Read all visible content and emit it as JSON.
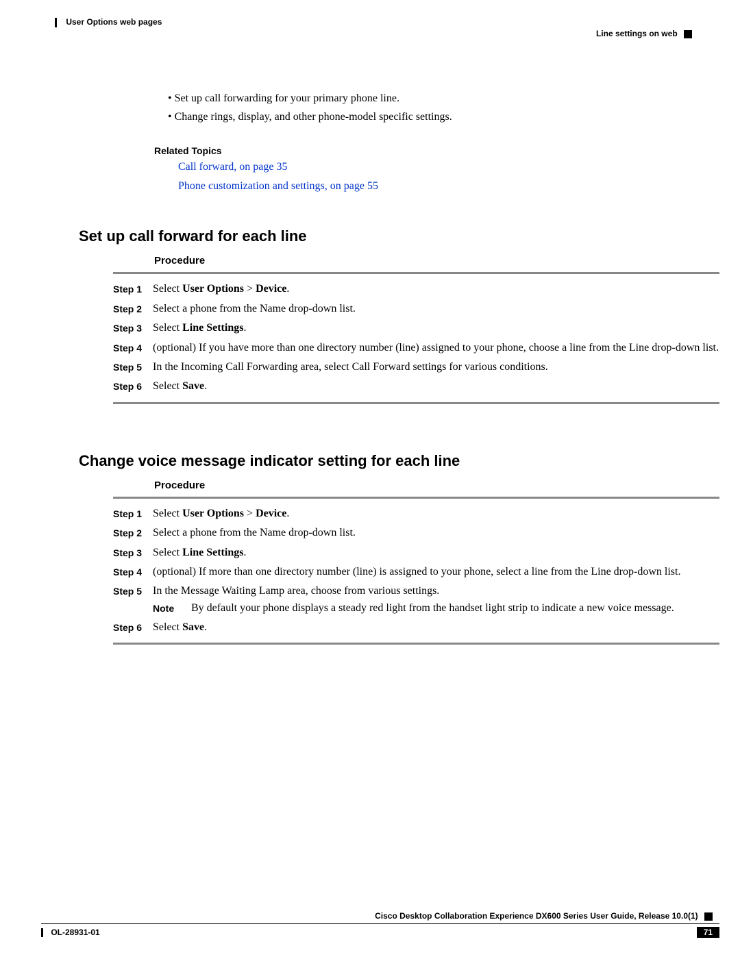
{
  "header": {
    "left": "User Options web pages",
    "right": "Line settings on web"
  },
  "intro": {
    "bullets": [
      "Set up call forwarding for your primary phone line.",
      "Change rings, display, and other phone-model specific settings."
    ],
    "related_heading": "Related Topics",
    "links": [
      "Call forward,  on page 35",
      "Phone customization and settings,  on page 55"
    ]
  },
  "sections": [
    {
      "title": "Set up call forward for each line",
      "procedure_heading": "Procedure",
      "steps": [
        {
          "label": "Step 1",
          "html": "Select <b>User Options</b> > <b>Device</b>."
        },
        {
          "label": "Step 2",
          "html": "Select a phone from the Name drop-down list."
        },
        {
          "label": "Step 3",
          "html": "Select <b>Line Settings</b>."
        },
        {
          "label": "Step 4",
          "html": "(optional) If you have more than one directory number (line) assigned to your phone, choose a line from the Line drop-down list."
        },
        {
          "label": "Step 5",
          "html": "In the Incoming Call Forwarding area, select Call Forward settings for various conditions."
        },
        {
          "label": "Step 6",
          "html": "Select <b>Save</b>."
        }
      ]
    },
    {
      "title": "Change voice message indicator setting for each line",
      "procedure_heading": "Procedure",
      "steps": [
        {
          "label": "Step 1",
          "html": "Select <b>User Options</b> > <b>Device</b>."
        },
        {
          "label": "Step 2",
          "html": "Select a phone from the Name drop-down list."
        },
        {
          "label": "Step 3",
          "html": "Select <b>Line Settings</b>."
        },
        {
          "label": "Step 4",
          "html": "(optional) If more than one directory number (line) is assigned to your phone, select a line from the Line drop-down list."
        },
        {
          "label": "Step 5",
          "html": "In the Message Waiting Lamp area, choose from various settings.",
          "note": {
            "label": "Note",
            "text": "By default your phone displays a steady red light from the handset light strip to indicate a new voice message."
          }
        },
        {
          "label": "Step 6",
          "html": "Select <b>Save</b>."
        }
      ]
    }
  ],
  "footer": {
    "title": "Cisco Desktop Collaboration Experience DX600 Series User Guide, Release 10.0(1)",
    "doc_id": "OL-28931-01",
    "page": "71"
  }
}
